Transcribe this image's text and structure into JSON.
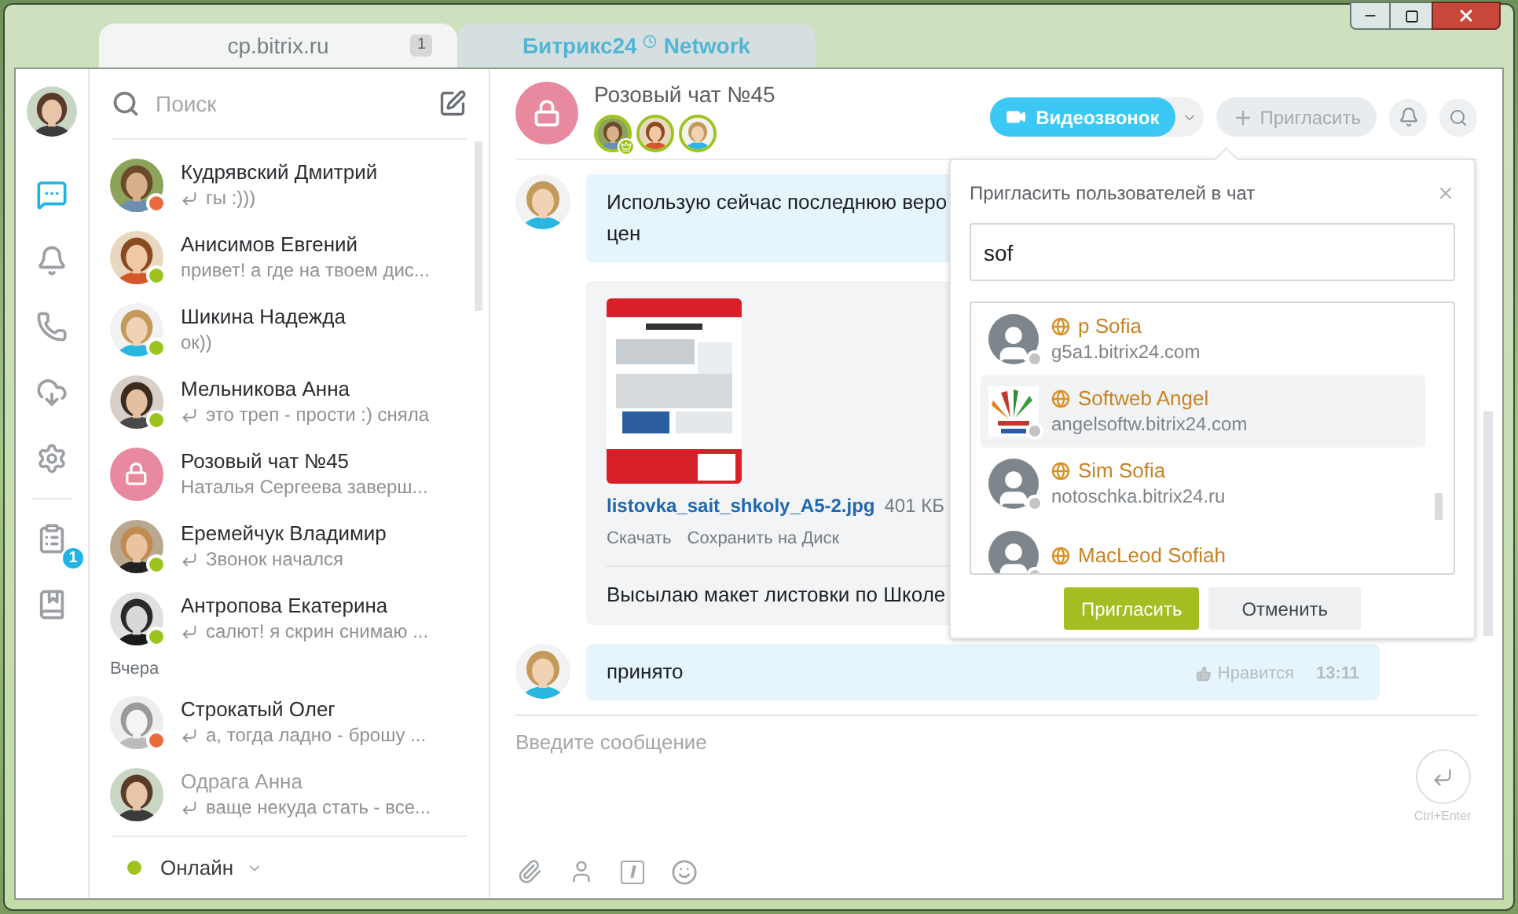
{
  "tabs": [
    {
      "label": "cp.bitrix.ru",
      "badge": "1",
      "selected": true
    },
    {
      "label": "Битрикс24",
      "label_suffix": "Network",
      "selected": false
    }
  ],
  "rail": {
    "top": [
      {
        "selected": true
      },
      {
        "selected": false
      },
      {
        "selected": false
      },
      {
        "selected": false
      },
      {
        "selected": false
      }
    ],
    "bottom": [
      {
        "badge": "1",
        "selected": false
      },
      {
        "selected": false
      }
    ]
  },
  "search": {
    "placeholder": "Поиск"
  },
  "contacts": [
    {
      "kind": "person",
      "name": "Кудрявский Дмитрий",
      "preview": "гы :)))",
      "reply": true,
      "color": "#e96b3c",
      "offline": false
    },
    {
      "kind": "person",
      "name": "Анисимов Евгений",
      "preview": "привет! а где на твоем дис...",
      "reply": false,
      "color": "#9dc41d",
      "offline": false
    },
    {
      "kind": "person",
      "name": "Шикина Надежда",
      "preview": "ок))",
      "reply": false,
      "color": "#9dc41d",
      "offline": false
    },
    {
      "kind": "person",
      "name": "Мельникова Анна",
      "preview": "это треп - прости :) сняла",
      "reply": true,
      "color": "#9dc41d",
      "offline": false
    },
    {
      "kind": "group",
      "name": "Розовый чат №45",
      "preview": "Наталья Сергеева заверш...",
      "reply": false,
      "offline": false
    },
    {
      "kind": "person",
      "name": "Еремейчук Владимир",
      "preview": "Звонок начался",
      "reply": true,
      "color": "#9dc41d",
      "offline": false
    },
    {
      "kind": "person",
      "name": "Антропова Екатерина",
      "preview": "салют! я скрин снимаю ...",
      "reply": true,
      "color": "#9dc41d",
      "offline": false
    },
    {
      "kind": "section",
      "label": "Вчера"
    },
    {
      "kind": "person",
      "name": "Строкатый Олег",
      "preview": "а, тогда ладно - брошу ...",
      "reply": true,
      "color": "#e96b3c",
      "offline": false
    },
    {
      "kind": "person",
      "name": "Одрага Анна",
      "preview": "ваще некуда стать - все...",
      "reply": true,
      "offline": true
    }
  ],
  "presence": {
    "label": "Онлайн",
    "color": "#9dc41d"
  },
  "chat": {
    "title": "Розовый чат №45",
    "members": [
      {
        "owner": true
      },
      {
        "owner": false
      },
      {
        "owner": false
      }
    ],
    "video_button": "Видеозвонок",
    "invite_button": "Пригласить",
    "invite_open": true
  },
  "messages": [
    {
      "kind": "text",
      "avatar": true,
      "lines": [
        "Использую сейчас последнюю веро",
        "цен"
      ]
    },
    {
      "kind": "file",
      "avatar": false,
      "file_name": "listovka_sait_shkoly_A5-2.jpg",
      "file_size": "401 КБ",
      "links": [
        "Скачать",
        "Сохранить на Диск"
      ],
      "text": "Высылаю макет листовки по Школе"
    },
    {
      "kind": "text",
      "avatar": true,
      "lines": [
        "принято"
      ],
      "like": "Нравится",
      "time": "13:11"
    }
  ],
  "composer": {
    "placeholder": "Введите сообщение",
    "send_hint": "Ctrl+Enter"
  },
  "invite_popup": {
    "title": "Пригласить пользователей в чат",
    "query": "sof",
    "results": [
      {
        "name": "p Sofia",
        "domain": "g5a1.bitrix24.com",
        "kind": "default",
        "selected": false
      },
      {
        "name": "Softweb Angel",
        "domain": "angelsoftw.bitrix24.com",
        "kind": "picture",
        "selected": true
      },
      {
        "name": "Sim Sofia",
        "domain": "notoschka.bitrix24.ru",
        "kind": "default",
        "selected": false
      },
      {
        "name": "MacLeod Sofiah",
        "kind": "default",
        "selected": false
      }
    ],
    "buttons": [
      {
        "label": "Пригласить",
        "kind": "primary"
      },
      {
        "label": "Отменить",
        "kind": "secondary"
      }
    ]
  }
}
